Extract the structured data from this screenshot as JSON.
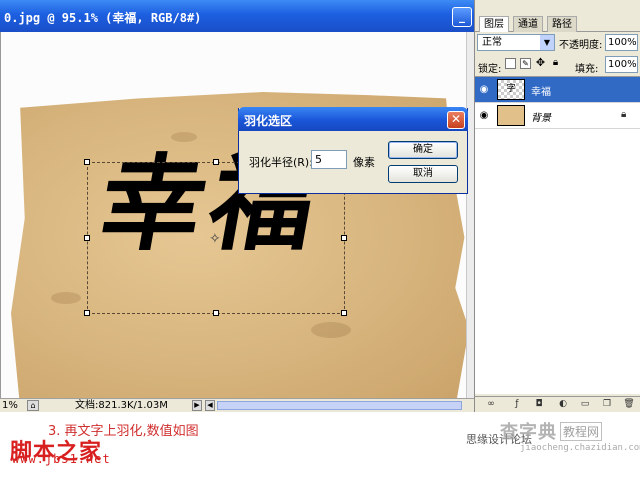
{
  "document": {
    "title": "0.jpg @ 95.1% (幸福, RGB/8#)",
    "minimize_glyph": "_",
    "artwork_text": "幸福",
    "status": {
      "zoom": "1%",
      "doc_size": "文档:821.3K/1.03M"
    }
  },
  "dialog": {
    "title": "羽化选区",
    "close_glyph": "✕",
    "radius_label": "羽化半径(R):",
    "radius_value": "5",
    "unit": "像素",
    "ok_label": "确定",
    "cancel_label": "取消"
  },
  "layers_panel": {
    "tabs": [
      "图层",
      "通道",
      "路径"
    ],
    "blend_mode": "正常",
    "opacity_label": "不透明度:",
    "opacity_value": "100%",
    "lock_label": "锁定:",
    "fill_label": "填充:",
    "fill_value": "100%",
    "layers": [
      {
        "name": "幸福",
        "thumb_text": "字",
        "selected": true
      },
      {
        "name": "背景",
        "selected": false,
        "locked": true
      }
    ]
  },
  "caption": {
    "step": "3. 再文字上羽化,数值如图",
    "logo": "脚本之家",
    "url": "www.jb51.net",
    "watermark_left": "思缘设计论坛",
    "watermark_right": "查字典",
    "watermark_box": "教程网",
    "watermark_url": "jiaocheng.chazidian.com"
  },
  "colors": {
    "title_bar": "#1c5fe0",
    "selected_layer": "#316ac5",
    "caption_red": "#d12e2e"
  }
}
